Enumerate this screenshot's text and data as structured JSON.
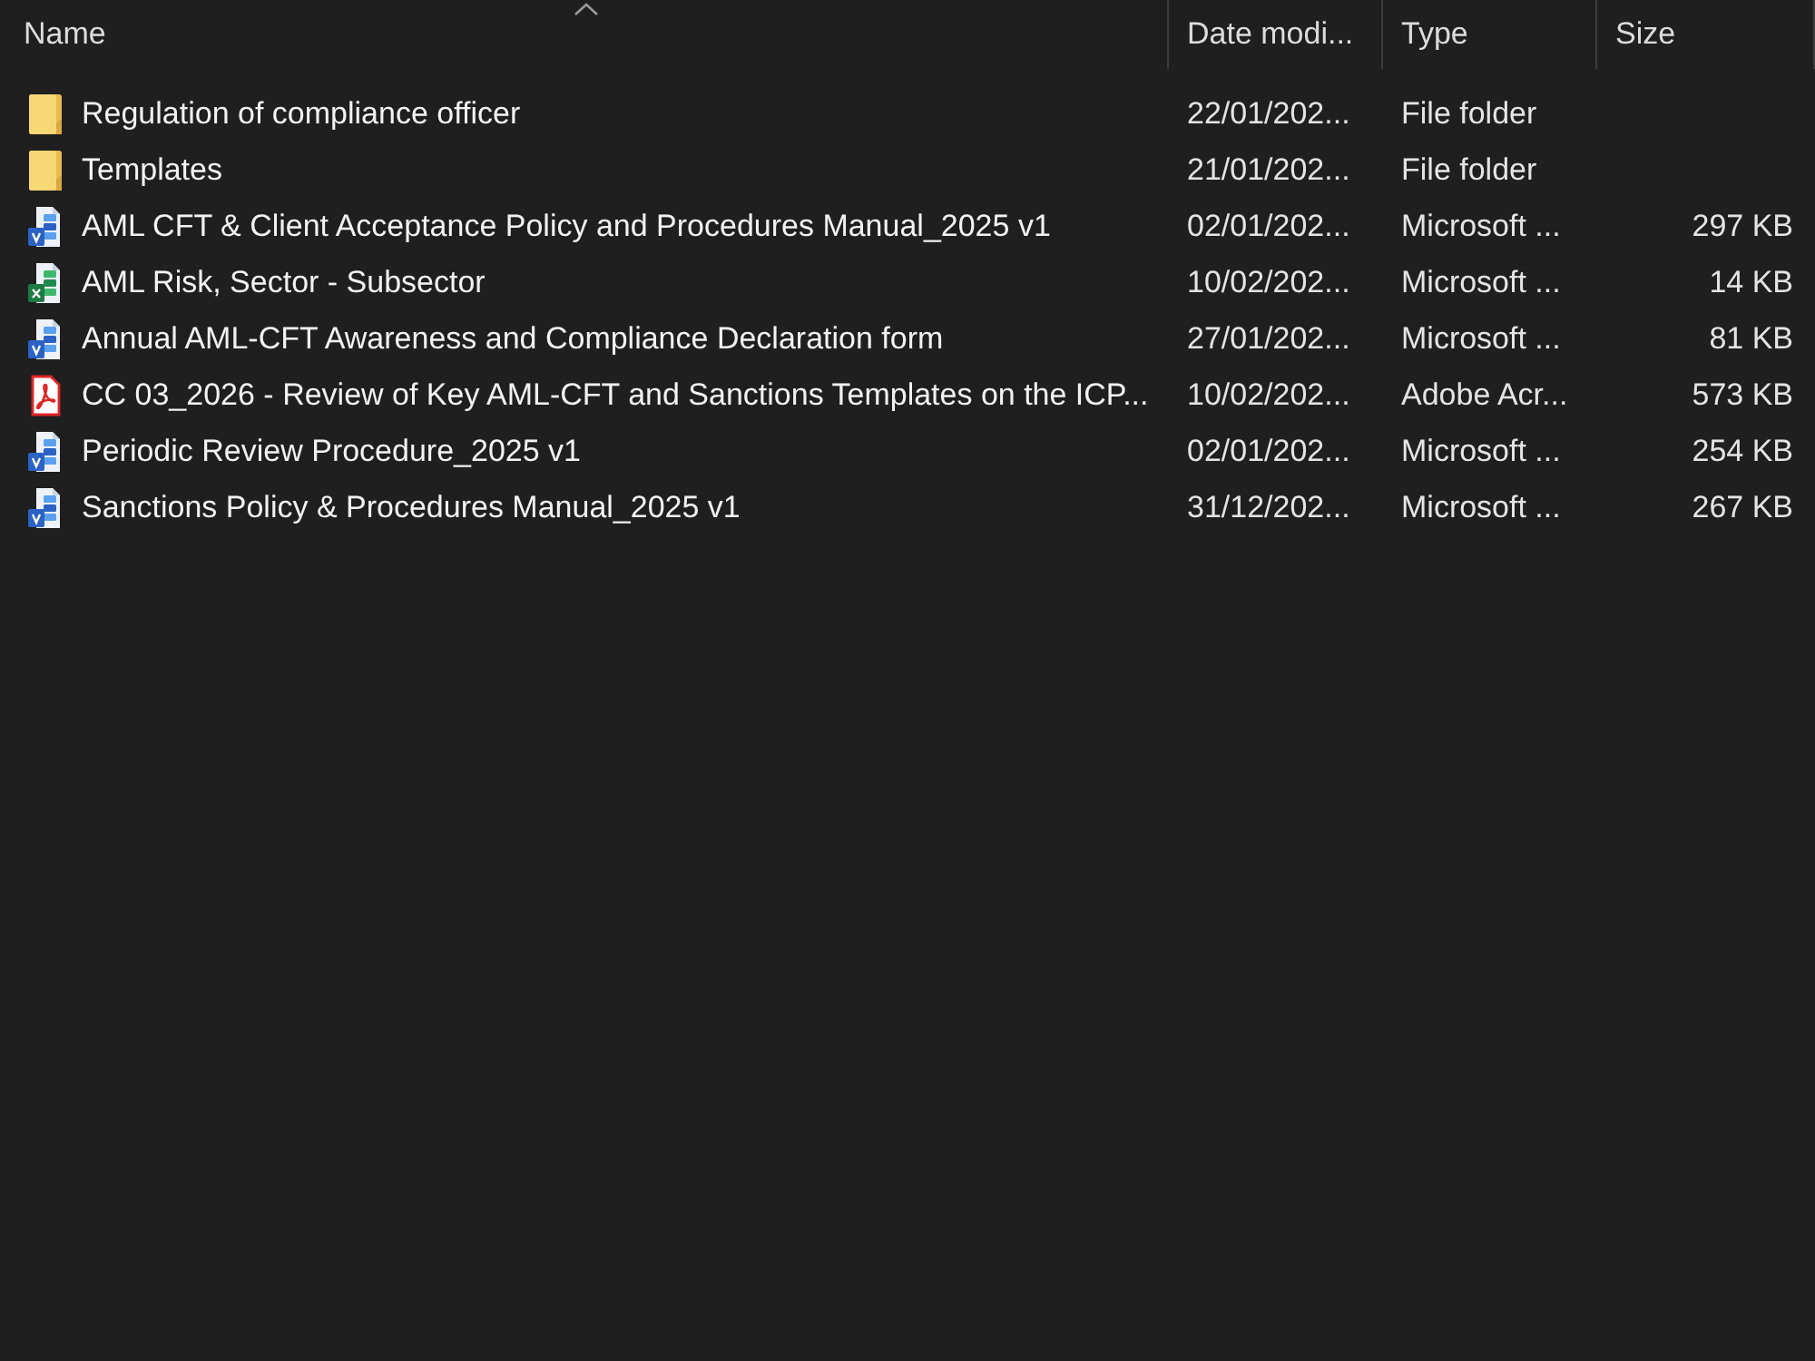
{
  "columns": [
    {
      "label": "Name",
      "sorted": true
    },
    {
      "label": "Date modi...",
      "sorted": false
    },
    {
      "label": "Type",
      "sorted": false
    },
    {
      "label": "Size",
      "sorted": false
    }
  ],
  "rows": [
    {
      "kind": "folder",
      "name": "Regulation of compliance officer",
      "date_modified": "22/01/202...",
      "type": "File folder"
    },
    {
      "kind": "folder",
      "name": "Templates",
      "date_modified": "21/01/202...",
      "type": "File folder"
    },
    {
      "kind": "word",
      "name": "AML CFT & Client Acceptance Policy and Procedures Manual_2025 v1",
      "date_modified": "02/01/202...",
      "type": "Microsoft ...",
      "size": "297 KB"
    },
    {
      "kind": "excel",
      "name": "AML Risk, Sector - Subsector",
      "date_modified": "10/02/202...",
      "type": "Microsoft ...",
      "size": "14 KB"
    },
    {
      "kind": "word",
      "name": "Annual AML-CFT Awareness and Compliance Declaration form",
      "date_modified": "27/01/202...",
      "type": "Microsoft ...",
      "size": "81 KB"
    },
    {
      "kind": "pdf",
      "name": "CC 03_2026 - Review of Key AML-CFT and Sanctions Templates on the ICP...",
      "date_modified": "10/02/202...",
      "type": "Adobe Acr...",
      "size": "573 KB"
    },
    {
      "kind": "word",
      "name": "Periodic Review Procedure_2025 v1",
      "date_modified": "02/01/202...",
      "type": "Microsoft ...",
      "size": "254 KB"
    },
    {
      "kind": "word",
      "name": "Sanctions Policy & Procedures Manual_2025 v1",
      "date_modified": "31/12/202...",
      "type": "Microsoft ...",
      "size": "267 KB"
    }
  ]
}
